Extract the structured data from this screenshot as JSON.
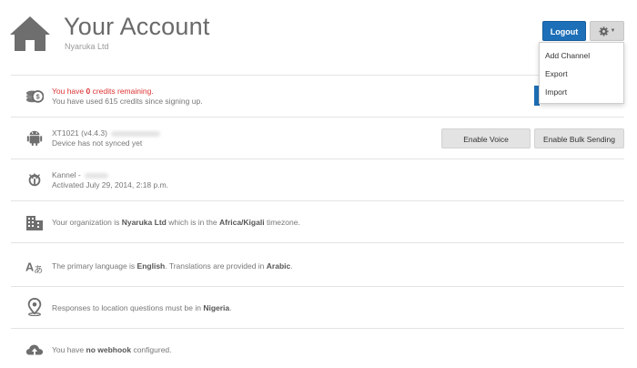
{
  "header": {
    "title": "Your Account",
    "subtitle": "Nyaruka Ltd",
    "logout_label": "Logout",
    "settings_icon": "gear-icon"
  },
  "dropdown": {
    "items": [
      {
        "label": "Add Channel"
      },
      {
        "label": "Export"
      },
      {
        "label": "Import"
      }
    ]
  },
  "credits": {
    "line1_prefix": "You have ",
    "line1_count": "0",
    "line1_suffix": " credits remaining.",
    "line2": "You have used 615 credits since signing up."
  },
  "android_channel": {
    "name": "XT1021 (v4.4.3)",
    "status": "Device has not synced yet",
    "enable_voice_label": "Enable Voice",
    "enable_bulk_label": "Enable Bulk Sending"
  },
  "kannel_channel": {
    "name": "Kannel -",
    "activated": "Activated July 29, 2014, 2:18 p.m."
  },
  "organization": {
    "prefix": "Your organization is ",
    "name": "Nyaruka Ltd",
    "middle": " which is in the ",
    "timezone": "Africa/Kigali",
    "suffix": " timezone."
  },
  "language": {
    "prefix": "The primary language is ",
    "primary": "English",
    "middle": ". Translations are provided in ",
    "translation": "Arabic",
    "suffix": "."
  },
  "location": {
    "prefix": "Responses to location questions must be in ",
    "country": "Nigeria",
    "suffix": "."
  },
  "webhook": {
    "prefix": "You have ",
    "emph": "no webhook",
    "suffix": " configured."
  },
  "colors": {
    "primary_button": "#1d6fb8",
    "alert_text": "#dd3333"
  }
}
